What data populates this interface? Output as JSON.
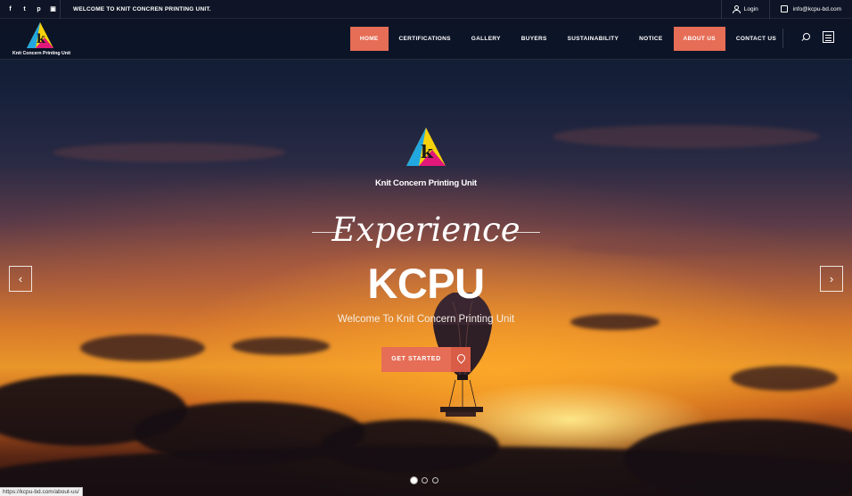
{
  "topbar": {
    "social": [
      {
        "icon": "facebook-icon",
        "glyph": "f"
      },
      {
        "icon": "twitter-icon",
        "glyph": "t"
      },
      {
        "icon": "pinterest-icon",
        "glyph": "p"
      },
      {
        "icon": "instagram-icon",
        "glyph": "▣"
      }
    ],
    "welcome": "WELCOME TO KNIT CONCREN PRINTING UNIT.",
    "login": "Login",
    "email": "info@kcpu-bd.com"
  },
  "brand": {
    "name": "Knit Concern Printing Unit"
  },
  "nav": {
    "items": [
      {
        "label": "HOME",
        "active": true
      },
      {
        "label": "CERTIFICATIONS",
        "active": false
      },
      {
        "label": "GALLERY",
        "active": false
      },
      {
        "label": "BUYERS",
        "active": false
      },
      {
        "label": "SUSTAINABILITY",
        "active": false
      },
      {
        "label": "NOTICE",
        "active": false
      },
      {
        "label": "ABOUT US",
        "active": true
      },
      {
        "label": "CONTACT US",
        "active": false
      }
    ]
  },
  "hero": {
    "logo_text": "Knit Concern Printing Unit",
    "tagline": "Experience",
    "title": "KCPU",
    "subtitle": "Welcome To Knit Concern Printing Unit",
    "cta_label": "GET STARTED",
    "prev_glyph": "‹",
    "next_glyph": "›",
    "slides": 3,
    "active_slide": 1
  },
  "status_bar": {
    "url": "https://kcpu-bd.com/about-us/"
  },
  "colors": {
    "accent": "#e66d56",
    "nav_bg": "#0c1426"
  }
}
